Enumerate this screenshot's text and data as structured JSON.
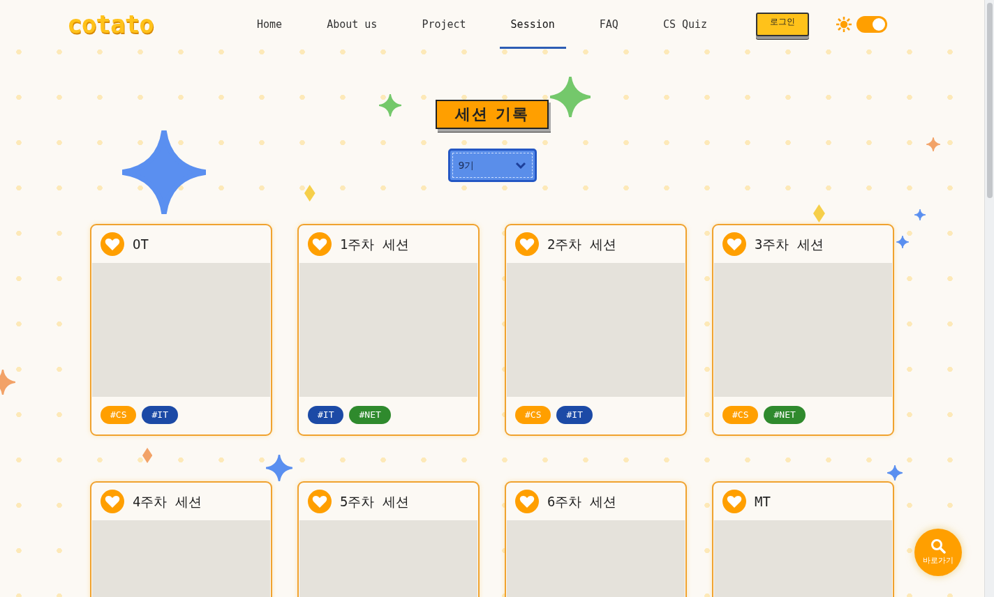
{
  "navbar": {
    "logo": "cotato",
    "links": [
      {
        "label": "Home",
        "selected": false
      },
      {
        "label": "About us",
        "selected": false
      },
      {
        "label": "Project",
        "selected": false
      },
      {
        "label": "Session",
        "selected": true
      },
      {
        "label": "FAQ",
        "selected": false
      },
      {
        "label": "CS Quiz",
        "selected": false
      }
    ],
    "login_button": "로그인",
    "theme_toggle": {
      "on": true
    }
  },
  "page_title": "세션 기록",
  "generation_select": {
    "value": "9기"
  },
  "sessions": [
    {
      "title": "OT",
      "tags": [
        {
          "label": "#CS",
          "color": "#ff9f00"
        },
        {
          "label": "#IT",
          "color": "#1c4aa6"
        }
      ]
    },
    {
      "title": "1주차 세션",
      "tags": [
        {
          "label": "#IT",
          "color": "#1c4aa6"
        },
        {
          "label": "#NET",
          "color": "#2f8a2d"
        }
      ]
    },
    {
      "title": "2주차 세션",
      "tags": [
        {
          "label": "#CS",
          "color": "#ff9f00"
        },
        {
          "label": "#IT",
          "color": "#1c4aa6"
        }
      ]
    },
    {
      "title": "3주차 세션",
      "tags": [
        {
          "label": "#CS",
          "color": "#ff9f00"
        },
        {
          "label": "#NET",
          "color": "#2f8a2d"
        }
      ]
    },
    {
      "title": "4주차 세션"
    },
    {
      "title": "5주차 세션"
    },
    {
      "title": "6주차 세션"
    },
    {
      "title": "MT"
    }
  ],
  "quick_button": {
    "label": "바로가기"
  }
}
